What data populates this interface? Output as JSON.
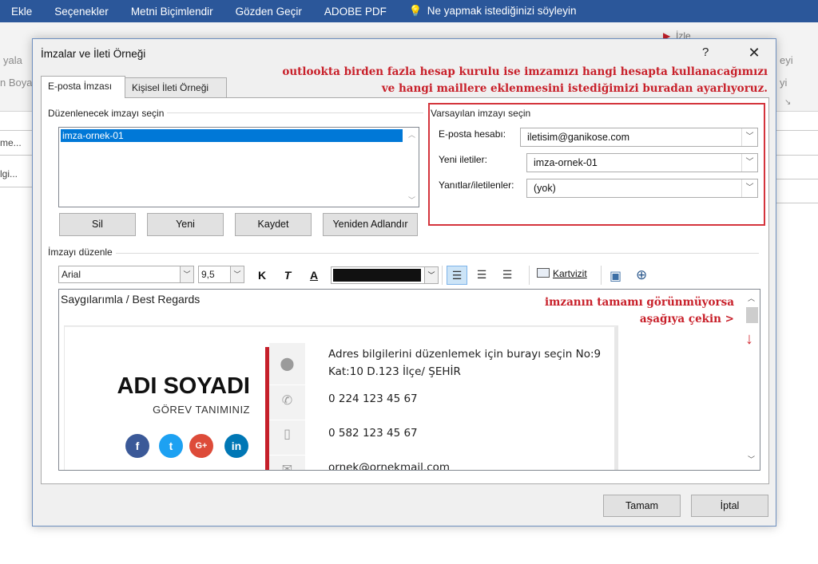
{
  "ribbon": {
    "tabs": [
      "Ekle",
      "Seçenekler",
      "Metni Biçimlendir",
      "Gözden Geçir",
      "ADOBE PDF",
      "Ne yapmak istediğinizi söyleyin"
    ],
    "left_fragments": [
      "yala",
      "n Boya"
    ],
    "right_fragments": [
      "eyi",
      "yi"
    ],
    "right_dialog_launcher": "↘",
    "partial_button": "İzle"
  },
  "background_rows": [
    "me...",
    "lgi..."
  ],
  "dialog": {
    "title": "İmzalar ve İleti Örneği",
    "help_label": "?",
    "close_label": "✕",
    "tabs": [
      {
        "label": "E-posta İmzası",
        "active": true
      },
      {
        "label": "Kişisel İleti Örneği",
        "active": false
      }
    ],
    "annotation_top": [
      "outlookta birden fazla hesap kurulu ise imzamızı hangi hesapta kullanacağımızı",
      "ve hangi maillere eklenmesini istediğimizi buradan ayarlıyoruz."
    ],
    "select_label": "Düzenlenecek imzayı seçin",
    "signatures": [
      "imza-ornek-01"
    ],
    "buttons": {
      "delete": "Sil",
      "new": "Yeni",
      "save": "Kaydet",
      "rename": "Yeniden Adlandır"
    },
    "defaults": {
      "group_label": "Varsayılan imzayı seçin",
      "account_label": "E-posta hesabı:",
      "account_value": "iletisim@ganikose.com",
      "new_messages_label": "Yeni iletiler:",
      "new_messages_value": "imza-ornek-01",
      "replies_label": "Yanıtlar/iletilenler:",
      "replies_value": "(yok)"
    },
    "edit_label": "İmzayı düzenle",
    "toolbar": {
      "font": "Arial",
      "size": "9,5",
      "bold": "K",
      "italic": "T",
      "underline": "A",
      "color_hex": "#111111",
      "business_card": "Kartvizit"
    },
    "editor": {
      "greeting": "Saygılarımla / Best Regards",
      "annotation_right": [
        "imzanın tamamı görünmüyorsa",
        "aşağıya çekin >"
      ],
      "name": "ADI SOYADI",
      "role": "GÖREV TANIMINIZ",
      "social": [
        {
          "label": "f",
          "color": "#3b5998"
        },
        {
          "label": "t",
          "color": "#1da1f2"
        },
        {
          "label": "G+",
          "color": "#dd4b39"
        },
        {
          "label": "in",
          "color": "#0077b5"
        }
      ],
      "address_line1": "Adres bilgilerini düzenlemek için burayı seçin No:9",
      "address_line2": "Kat:10 D.123 İlçe/ ŞEHİR",
      "phone": "0 224 123 45 67",
      "mobile": "0 582 123 45 67",
      "email": "ornek@ornekmail.com"
    },
    "footer": {
      "ok": "Tamam",
      "cancel": "İptal"
    }
  },
  "colors": {
    "ribbon_blue": "#2b579a",
    "accent_red": "#c51f2a",
    "selection_blue": "#0078d7"
  }
}
